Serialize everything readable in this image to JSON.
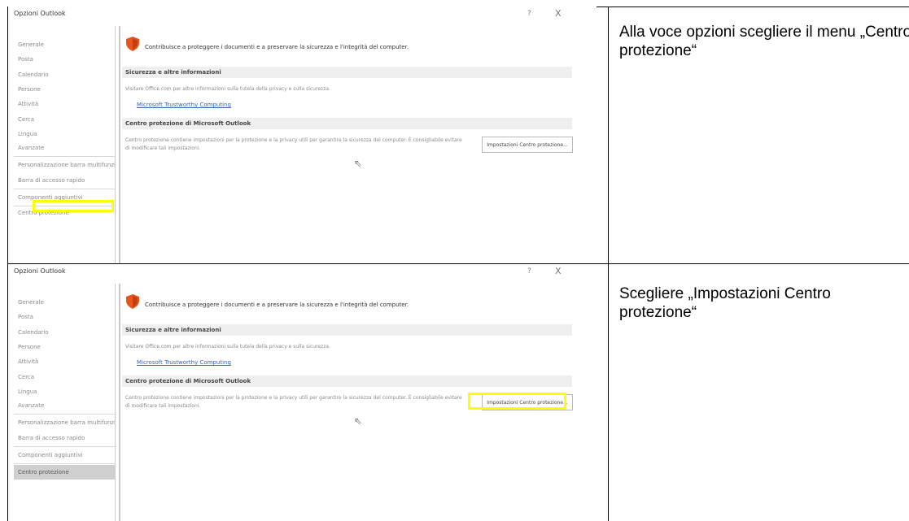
{
  "rows": [
    {
      "screenshot": {
        "window_title": "Opzioni Outlook",
        "help_glyph": "?",
        "close_glyph": "X",
        "nav_items": [
          {
            "label": "Generale"
          },
          {
            "label": "Posta"
          },
          {
            "label": "Calendario"
          },
          {
            "label": "Persone"
          },
          {
            "label": "Attività"
          },
          {
            "label": "Cerca"
          },
          {
            "label": "Lingua"
          },
          {
            "label": "Avanzate"
          },
          {
            "label": "Personalizzazione barra multifunzione"
          },
          {
            "label": "Barra di accesso rapido"
          },
          {
            "label": "Componenti aggiuntivi"
          },
          {
            "label": "Centro protezione"
          }
        ],
        "selected_nav": "Centro protezione",
        "intro": "Contribuisce a proteggere i documenti e a preservare la sicurezza e l'integrità del computer.",
        "section1_title": "Sicurezza e altre informazioni",
        "section1_text": "Visitare Office.com per altre informazioni sulla tutela della privacy e sulla sicurezza.",
        "link": "Microsoft Trustworthy Computing",
        "section2_title": "Centro protezione di Microsoft Outlook",
        "section2_text": "Centro protezione contiene impostazioni per la protezione e la privacy utili per garantire la sicurezza del computer. È consigliabile evitare di modificare tali impostazioni.",
        "button_label": "Impostazioni Centro protezione..."
      },
      "instruction": "Alla voce opzioni scegliere il menu „Centro protezione“"
    },
    {
      "screenshot": {
        "window_title": "Opzioni Outlook",
        "help_glyph": "?",
        "close_glyph": "X",
        "nav_items": [
          {
            "label": "Generale"
          },
          {
            "label": "Posta"
          },
          {
            "label": "Calendario"
          },
          {
            "label": "Persone"
          },
          {
            "label": "Attività"
          },
          {
            "label": "Cerca"
          },
          {
            "label": "Lingua"
          },
          {
            "label": "Avanzate"
          },
          {
            "label": "Personalizzazione barra multifunzione"
          },
          {
            "label": "Barra di accesso rapido"
          },
          {
            "label": "Componenti aggiuntivi"
          },
          {
            "label": "Centro protezione"
          }
        ],
        "selected_nav": "Centro protezione",
        "intro": "Contribuisce a proteggere i documenti e a preservare la sicurezza e l'integrità del computer.",
        "section1_title": "Sicurezza e altre informazioni",
        "section1_text": "Visitare Office.com per altre informazioni sulla tutela della privacy e sulla sicurezza.",
        "link": "Microsoft Trustworthy Computing",
        "section2_title": "Centro protezione di Microsoft Outlook",
        "section2_text": "Centro protezione contiene impostazioni per la protezione e la privacy utili per garantire la sicurezza del computer. È consigliabile evitare di modificare tali impostazioni.",
        "button_label": "Impostazioni Centro protezione..."
      },
      "instruction": "Scegliere „Impostazioni Centro protezione“"
    }
  ],
  "colors": {
    "highlight": "#ffff00",
    "shield": "#e8541e",
    "link": "#3a62b7",
    "selected_nav_bg": "#cfcfcf"
  },
  "icons": {
    "shield": "shield-icon",
    "cursor": "mouse-cursor-icon",
    "help": "help-icon",
    "close": "close-icon"
  }
}
